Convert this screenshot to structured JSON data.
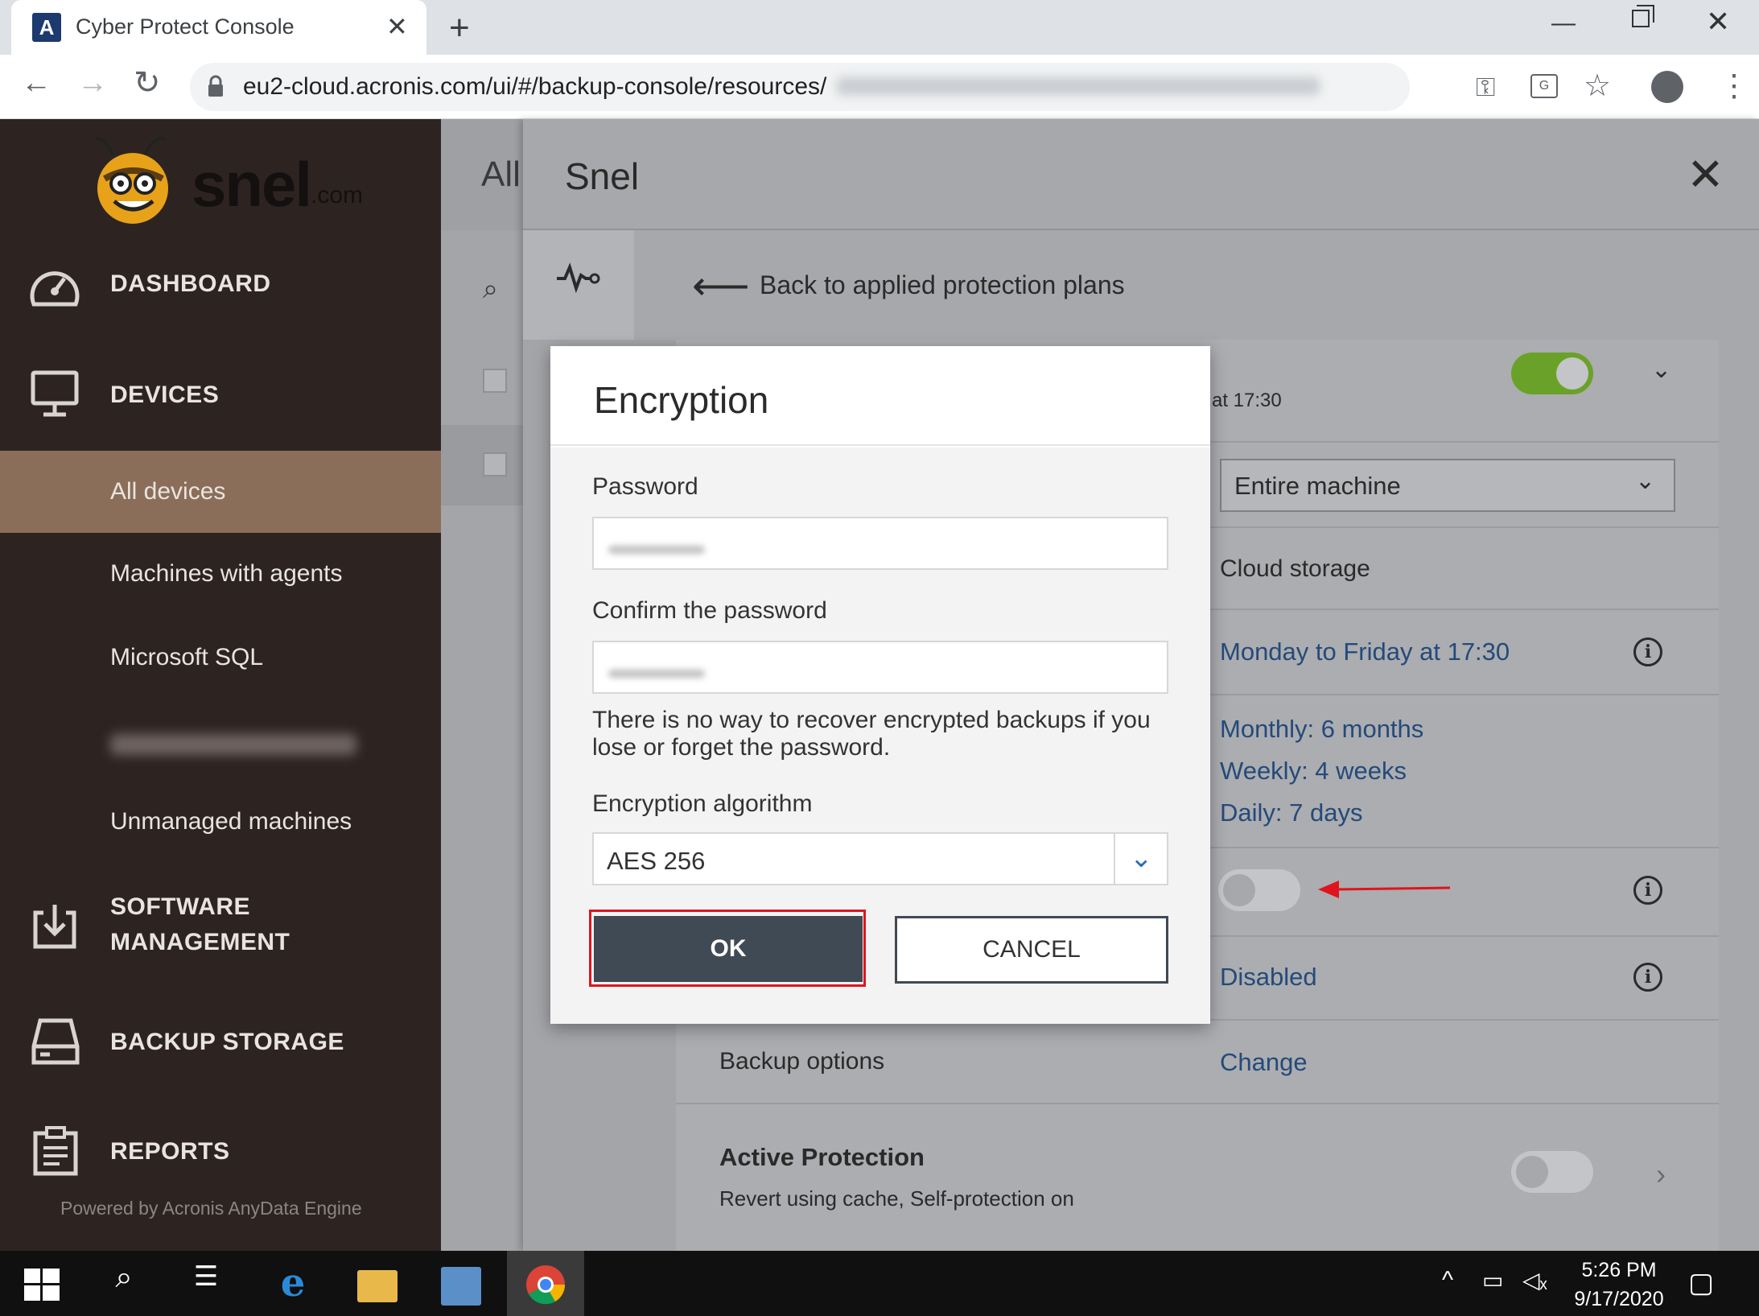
{
  "browser": {
    "tab_title": "Cyber Protect Console",
    "tab_favicon": "A",
    "url": "eu2-cloud.acronis.com/ui/#/backup-console/resources/"
  },
  "sidebar": {
    "logo_text": "snel",
    "logo_suffix": ".com",
    "items": [
      {
        "label": "DASHBOARD",
        "icon": "speedometer-icon"
      },
      {
        "label": "DEVICES",
        "icon": "monitor-icon"
      },
      {
        "label": "All devices"
      },
      {
        "label": "Machines with agents"
      },
      {
        "label": "Microsoft SQL"
      },
      {
        "label": "Unmanaged machines"
      },
      {
        "label": "SOFTWARE",
        "label2": "MANAGEMENT",
        "icon": "download-icon"
      },
      {
        "label": "BACKUP STORAGE",
        "icon": "drive-icon"
      },
      {
        "label": "REPORTS",
        "icon": "report-icon"
      }
    ],
    "powered_by": "Powered by Acronis AnyData Engine"
  },
  "content": {
    "heading": "All"
  },
  "panel": {
    "title": "Snel",
    "back_link": "Back to applied protection plans",
    "schedule_fragment": "at 17:30",
    "what_to_backup": "Entire machine",
    "where": "Cloud storage",
    "schedule": "Monday to Friday at 17:30",
    "retention": [
      "Monthly: 6 months",
      "Weekly: 4 weeks",
      "Daily: 7 days"
    ],
    "disabled_label": "Disabled",
    "backup_options_label": "Backup options",
    "backup_options_link": "Change",
    "active_protection_title": "Active Protection",
    "active_protection_sub": "Revert using cache, Self-protection on",
    "plan_enabled": true,
    "encryption_enabled": false,
    "active_protection_enabled": false
  },
  "modal": {
    "title": "Encryption",
    "password_label": "Password",
    "confirm_label": "Confirm the password",
    "warning": "There is no way to recover encrypted backups if you lose or forget the password.",
    "algorithm_label": "Encryption algorithm",
    "algorithm_value": "AES 256",
    "ok_label": "OK",
    "cancel_label": "CANCEL"
  },
  "taskbar": {
    "time": "5:26 PM",
    "date": "9/17/2020"
  },
  "colors": {
    "sidebar_bg": "#2d2422",
    "sidebar_active": "#8b6e5a",
    "toggle_on": "#6aa128",
    "link": "#254a7a",
    "ok_button": "#404a55",
    "highlight": "#e0141e"
  }
}
